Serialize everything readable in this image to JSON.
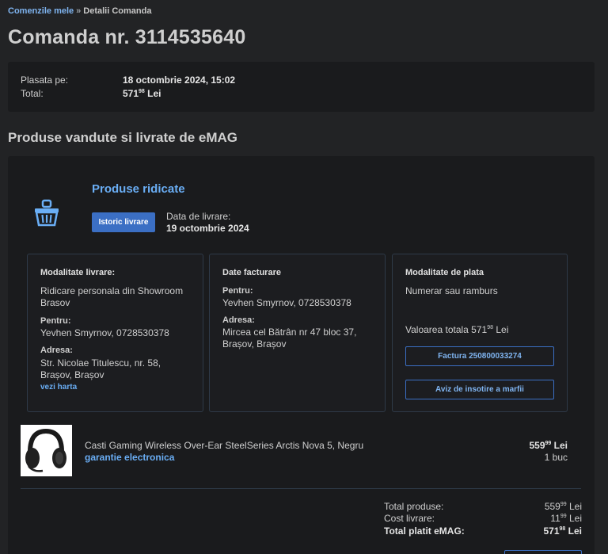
{
  "breadcrumb": {
    "parent": "Comenzile mele",
    "separator": "»",
    "current": "Detalii Comanda"
  },
  "page_title": "Comanda nr. 3114535640",
  "summary": {
    "placed_label": "Plasata pe:",
    "placed_value": "18 octombrie 2024, 15:02",
    "total_label": "Total:",
    "total_int": "571",
    "total_dec": "98",
    "total_currency": "Lei"
  },
  "section_title": "Produse vandute si livrate de eMAG",
  "shipment": {
    "status": "Produse ridicate",
    "history_button": "Istoric livrare",
    "delivery_date_label": "Data de livrare:",
    "delivery_date": "19 octombrie 2024",
    "status_icon": "basket-icon"
  },
  "delivery_box": {
    "title": "Modalitate livrare:",
    "method_line1": "Ridicare personala din Showroom",
    "method_line2": "Brasov",
    "for_label": "Pentru:",
    "for_value": "Yevhen Smyrnov, 0728530378",
    "address_label": "Adresa:",
    "address_line1": "Str. Nicolae Titulescu, nr. 58,",
    "address_line2": "Brașov, Brașov",
    "map_link": "vezi harta"
  },
  "billing_box": {
    "title": "Date facturare",
    "for_label": "Pentru:",
    "for_value": "Yevhen Smyrnov, 0728530378",
    "address_label": "Adresa:",
    "address_line1": "Mircea cel Bătrân nr 47 bloc 37,",
    "address_line2": "Brașov, Brașov"
  },
  "payment_box": {
    "title": "Modalitate de plata",
    "method": "Numerar sau ramburs",
    "total_prefix": "Valoarea totala 571",
    "total_dec": "98",
    "total_currency": "Lei",
    "invoice_button": "Factura 250800033274",
    "notice_button": "Aviz de insotire a marfii"
  },
  "product": {
    "image_icon": "headphones-icon",
    "name": "Casti Gaming Wireless Over-Ear SteelSeries Arctis Nova 5, Negru",
    "warranty_link": "garantie electronica",
    "price_int": "559",
    "price_dec": "99",
    "price_currency": "Lei",
    "quantity": "1 buc"
  },
  "totals": {
    "products_label": "Total produse:",
    "products_int": "559",
    "products_dec": "99",
    "shipping_label": "Cost livrare:",
    "shipping_int": "11",
    "shipping_dec": "99",
    "paid_label": "Total platit eMAG:",
    "paid_int": "571",
    "paid_dec": "98",
    "currency": "Lei"
  }
}
